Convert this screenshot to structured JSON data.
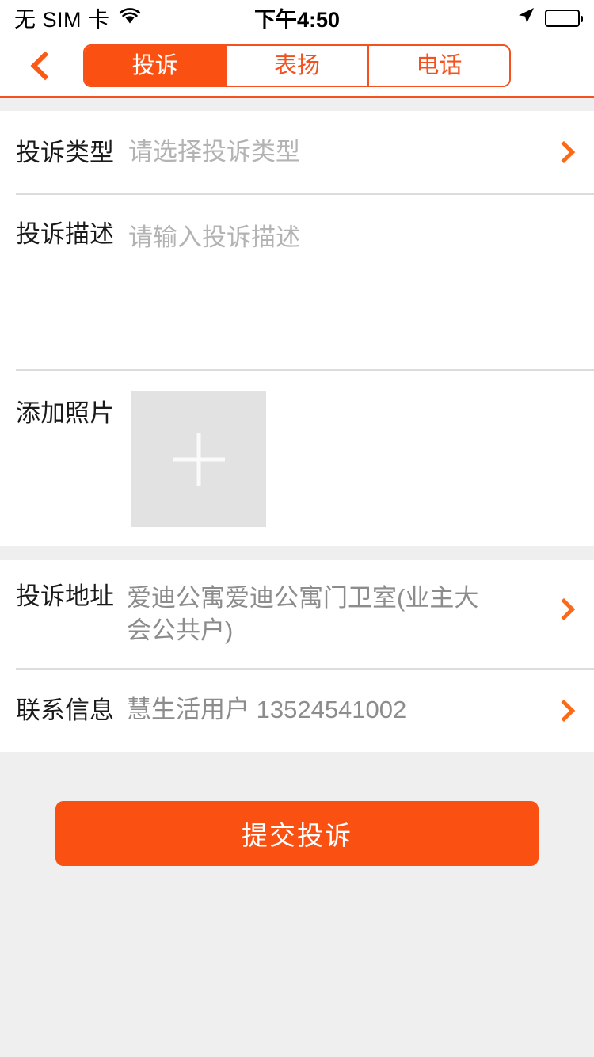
{
  "status_bar": {
    "carrier": "无 SIM 卡",
    "wifi_icon": "wifi-icon",
    "time": "下午4:50",
    "location_icon": "location-arrow-icon",
    "battery_icon": "battery-full-icon"
  },
  "navbar": {
    "back_icon": "chevron-left-icon",
    "tabs": [
      {
        "label": "投诉",
        "active": true
      },
      {
        "label": "表扬",
        "active": false
      },
      {
        "label": "电话",
        "active": false
      }
    ],
    "accent_color": "#fa5113",
    "border_color": "#f4511e"
  },
  "form": {
    "complaint_type": {
      "label": "投诉类型",
      "placeholder": "请选择投诉类型",
      "value": "",
      "chevron_icon": "chevron-right-icon"
    },
    "complaint_desc": {
      "label": "投诉描述",
      "placeholder": "请输入投诉描述",
      "value": ""
    },
    "add_photo": {
      "label": "添加照片",
      "add_icon": "plus-icon"
    },
    "complaint_address": {
      "label": "投诉地址",
      "value": "爱迪公寓爱迪公寓门卫室(业主大会公共户)",
      "chevron_icon": "chevron-right-icon"
    },
    "contact_info": {
      "label": "联系信息",
      "value": "慧生活用户 13524541002",
      "chevron_icon": "chevron-right-icon"
    }
  },
  "footer": {
    "submit_label": "提交投诉",
    "submit_color": "#fa5113"
  }
}
